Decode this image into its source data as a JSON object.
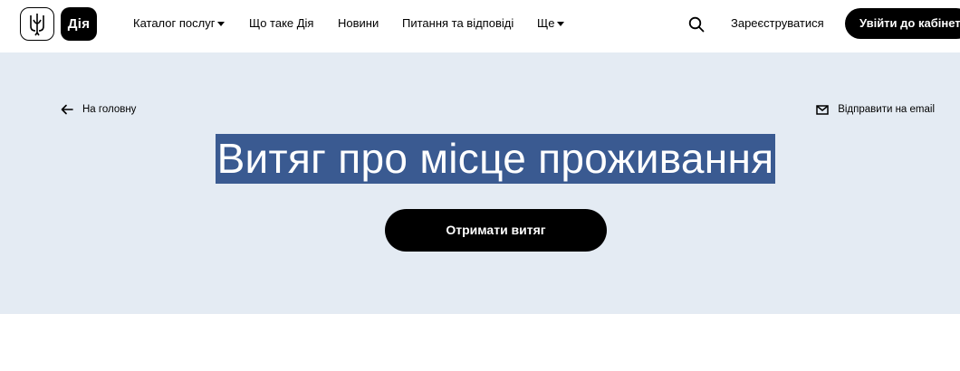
{
  "header": {
    "logo_text": "Дія",
    "nav": [
      {
        "label": "Каталог послуг",
        "has_dropdown": true
      },
      {
        "label": "Що таке Дія",
        "has_dropdown": false
      },
      {
        "label": "Новини",
        "has_dropdown": false
      },
      {
        "label": "Питання та відповіді",
        "has_dropdown": false
      },
      {
        "label": "Ще",
        "has_dropdown": true
      }
    ],
    "search_icon": "search-icon",
    "register_label": "Зареєструватися",
    "login_label": "Увійти до кабінету"
  },
  "hero": {
    "back_label": "На головну",
    "email_label": "Відправити на email",
    "title": "Витяг про місце проживання",
    "cta_label": "Отримати витяг"
  },
  "colors": {
    "hero_bg": "#e4ebf3",
    "selection": "#3a5a91",
    "button_bg": "#000000"
  }
}
